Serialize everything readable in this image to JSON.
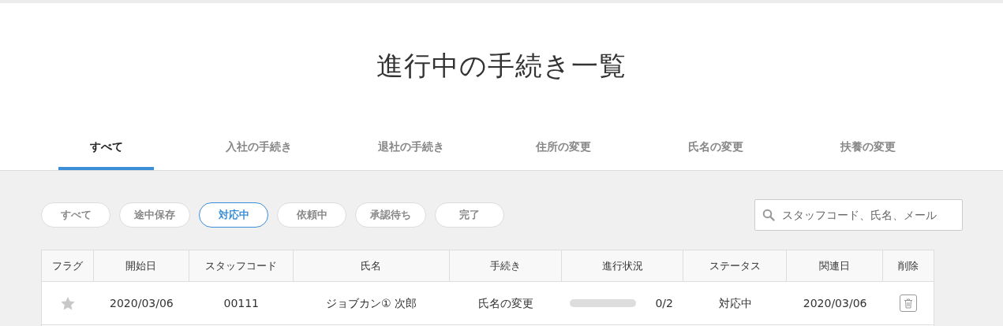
{
  "title": "進行中の手続き一覧",
  "tabs": [
    {
      "label": "すべて",
      "selected": true
    },
    {
      "label": "入社の手続き",
      "selected": false
    },
    {
      "label": "退社の手続き",
      "selected": false
    },
    {
      "label": "住所の変更",
      "selected": false
    },
    {
      "label": "氏名の変更",
      "selected": false
    },
    {
      "label": "扶養の変更",
      "selected": false
    }
  ],
  "filters": [
    {
      "label": "すべて",
      "selected": false
    },
    {
      "label": "途中保存",
      "selected": false
    },
    {
      "label": "対応中",
      "selected": true
    },
    {
      "label": "依頼中",
      "selected": false
    },
    {
      "label": "承認待ち",
      "selected": false
    },
    {
      "label": "完了",
      "selected": false
    }
  ],
  "search": {
    "placeholder": "スタッフコード、氏名、メール"
  },
  "table": {
    "columns": [
      "フラグ",
      "開始日",
      "スタッフコード",
      "氏名",
      "手続き",
      "進行状況",
      "ステータス",
      "関連日",
      "削除"
    ],
    "rows": [
      {
        "flagged": false,
        "start_date": "2020/03/06",
        "staff_code": "00111",
        "name": "ジョブカン① 次郎",
        "procedure": "氏名の変更",
        "progress": {
          "level": 0,
          "reading": "0/2"
        },
        "status": "対応中",
        "related_date": "2020/03/06"
      }
    ]
  }
}
